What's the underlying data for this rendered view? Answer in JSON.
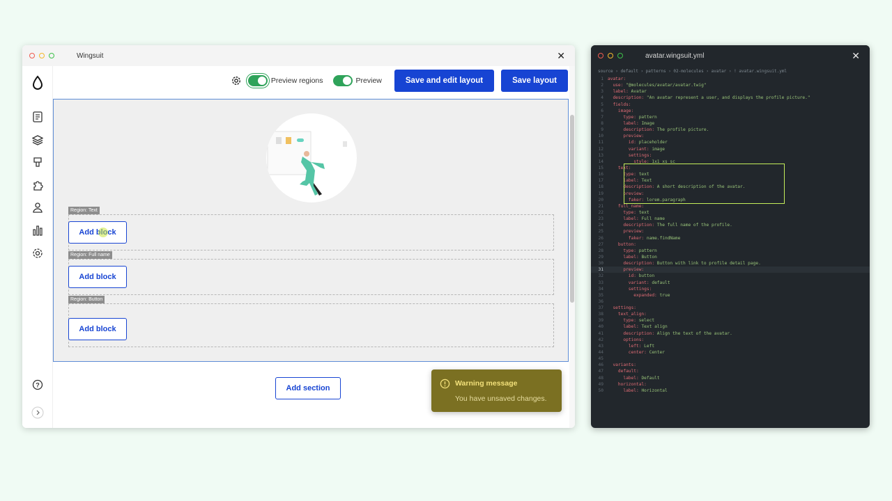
{
  "left_window": {
    "title": "Wingsuit",
    "toolbar": {
      "preview_regions_label": "Preview regions",
      "preview_label": "Preview",
      "save_edit_label": "Save and edit layout",
      "save_label": "Save layout"
    },
    "regions": [
      {
        "label": "Region: Text",
        "button": "Add block"
      },
      {
        "label": "Region: Full name",
        "button": "Add block"
      },
      {
        "label": "Region: Button",
        "button": "Add block"
      }
    ],
    "add_section_label": "Add section",
    "toast": {
      "title": "Warning message",
      "message": "You have unsaved changes."
    },
    "sidebar_icons": [
      "drop-logo-icon",
      "document-icon",
      "layers-icon",
      "paint-brush-icon",
      "puzzle-icon",
      "user-icon",
      "bar-chart-icon",
      "settings-icon",
      "help-icon",
      "chevron-right-icon"
    ],
    "accent_color": "#1744d3",
    "toggle_color": "#2fa35a",
    "warning_color": "#7b7022"
  },
  "right_window": {
    "title": "avatar.wingsuit.yml",
    "breadcrumb": [
      "source",
      "default",
      "patterns",
      "02-molecules",
      "avatar",
      "avatar.wingsuit.yml"
    ],
    "highlight_color": "#c6ef5b",
    "active_line": "31",
    "lines": [
      {
        "n": "1",
        "k": "avatar:",
        "v": ""
      },
      {
        "n": "2",
        "k": "  use: ",
        "v": "\"@molecules/avatar/avatar.twig\""
      },
      {
        "n": "3",
        "k": "  label: ",
        "v": "Avatar"
      },
      {
        "n": "4",
        "k": "  description: ",
        "v": "\"An avatar represent a user, and displays the profile picture.\""
      },
      {
        "n": "5",
        "k": "  fields:",
        "v": ""
      },
      {
        "n": "6",
        "k": "    image:",
        "v": ""
      },
      {
        "n": "7",
        "k": "      type: ",
        "v": "pattern"
      },
      {
        "n": "8",
        "k": "      label: ",
        "v": "Image"
      },
      {
        "n": "9",
        "k": "      description: ",
        "v": "The profile picture."
      },
      {
        "n": "10",
        "k": "      preview:",
        "v": ""
      },
      {
        "n": "11",
        "k": "        id: ",
        "v": "placeholder"
      },
      {
        "n": "12",
        "k": "        variant: ",
        "v": "image"
      },
      {
        "n": "13",
        "k": "        settings:",
        "v": ""
      },
      {
        "n": "14",
        "k": "          style: ",
        "v": "1x1 xs sc"
      },
      {
        "n": "15",
        "k": "    text:",
        "v": ""
      },
      {
        "n": "16",
        "k": "      type: ",
        "v": "text"
      },
      {
        "n": "17",
        "k": "      label: ",
        "v": "Text"
      },
      {
        "n": "18",
        "k": "      description: ",
        "v": "A short description of the avatar."
      },
      {
        "n": "19",
        "k": "      preview:",
        "v": ""
      },
      {
        "n": "20",
        "k": "        faker: ",
        "v": "lorem.paragraph"
      },
      {
        "n": "21",
        "k": "    full_name:",
        "v": ""
      },
      {
        "n": "22",
        "k": "      type: ",
        "v": "text"
      },
      {
        "n": "23",
        "k": "      label: ",
        "v": "Full name"
      },
      {
        "n": "24",
        "k": "      description: ",
        "v": "The full name of the profile."
      },
      {
        "n": "25",
        "k": "      preview:",
        "v": ""
      },
      {
        "n": "26",
        "k": "        faker: ",
        "v": "name.findName"
      },
      {
        "n": "27",
        "k": "    button:",
        "v": ""
      },
      {
        "n": "28",
        "k": "      type: ",
        "v": "pattern"
      },
      {
        "n": "29",
        "k": "      label: ",
        "v": "Button"
      },
      {
        "n": "30",
        "k": "      description: ",
        "v": "Button with link to profile detail page."
      },
      {
        "n": "31",
        "k": "      preview:",
        "v": ""
      },
      {
        "n": "32",
        "k": "        id: ",
        "v": "button"
      },
      {
        "n": "33",
        "k": "        variant: ",
        "v": "default"
      },
      {
        "n": "34",
        "k": "        settings:",
        "v": ""
      },
      {
        "n": "35",
        "k": "          expanded: ",
        "v": "true"
      },
      {
        "n": "36",
        "k": "",
        "v": ""
      },
      {
        "n": "37",
        "k": "  settings:",
        "v": ""
      },
      {
        "n": "38",
        "k": "    text_align:",
        "v": ""
      },
      {
        "n": "39",
        "k": "      type: ",
        "v": "select"
      },
      {
        "n": "40",
        "k": "      label: ",
        "v": "Text align"
      },
      {
        "n": "41",
        "k": "      description: ",
        "v": "Align the text of the avatar."
      },
      {
        "n": "42",
        "k": "      options:",
        "v": ""
      },
      {
        "n": "43",
        "k": "        left: ",
        "v": "Left"
      },
      {
        "n": "44",
        "k": "        center: ",
        "v": "Center"
      },
      {
        "n": "45",
        "k": "",
        "v": ""
      },
      {
        "n": "46",
        "k": "  variants:",
        "v": ""
      },
      {
        "n": "47",
        "k": "    default:",
        "v": ""
      },
      {
        "n": "48",
        "k": "      label: ",
        "v": "Default"
      },
      {
        "n": "49",
        "k": "    horizontal:",
        "v": ""
      },
      {
        "n": "50",
        "k": "      label: ",
        "v": "Horizontal"
      }
    ]
  }
}
